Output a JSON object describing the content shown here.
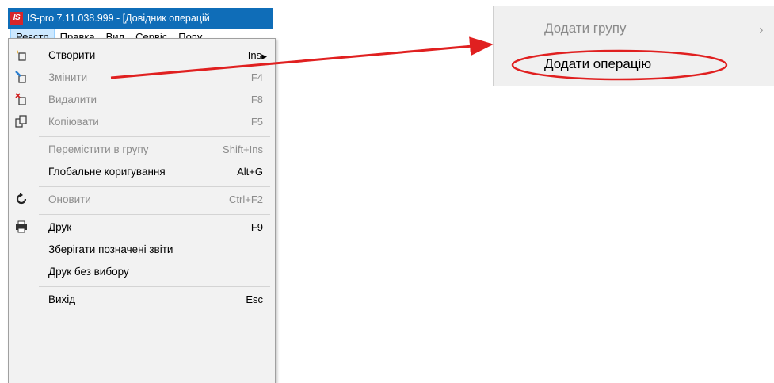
{
  "window": {
    "logo_text": "IS",
    "title": "IS-pro 7.11.038.999 - [Довідник операцій"
  },
  "menubar": {
    "items": [
      "Реєстр",
      "Правка",
      "Вид",
      "Сервіс",
      "Попу."
    ]
  },
  "dropdown": {
    "items": [
      {
        "label": "Створити",
        "shortcut": "Ins",
        "icon": "create-icon",
        "disabled": false
      },
      {
        "label": "Змінити",
        "shortcut": "F4",
        "icon": "edit-icon",
        "disabled": true
      },
      {
        "label": "Видалити",
        "shortcut": "F8",
        "icon": "delete-icon",
        "disabled": true
      },
      {
        "label": "Копіювати",
        "shortcut": "F5",
        "icon": "copy-icon",
        "disabled": true
      },
      {
        "label": "Перемістити в групу",
        "shortcut": "Shift+Ins",
        "icon": "",
        "disabled": true
      },
      {
        "label": "Глобальне коригування",
        "shortcut": "Alt+G",
        "icon": "",
        "disabled": false
      },
      {
        "label": "Оновити",
        "shortcut": "Ctrl+F2",
        "icon": "refresh-icon",
        "disabled": true
      },
      {
        "label": "Друк",
        "shortcut": "F9",
        "icon": "printer-icon",
        "disabled": false
      },
      {
        "label": "Зберігати позначені звіти",
        "shortcut": "",
        "icon": "",
        "disabled": false
      },
      {
        "label": "Друк без вибору",
        "shortcut": "",
        "icon": "",
        "disabled": false
      },
      {
        "label": "Вихід",
        "shortcut": "Esc",
        "icon": "",
        "disabled": false
      }
    ]
  },
  "submenu": {
    "items": [
      {
        "label": "Додати групу",
        "disabled": true
      },
      {
        "label": "Додати операцію",
        "disabled": false
      }
    ]
  },
  "annotation": {
    "arrow_color": "#e02020",
    "ellipse_color": "#e02020"
  }
}
